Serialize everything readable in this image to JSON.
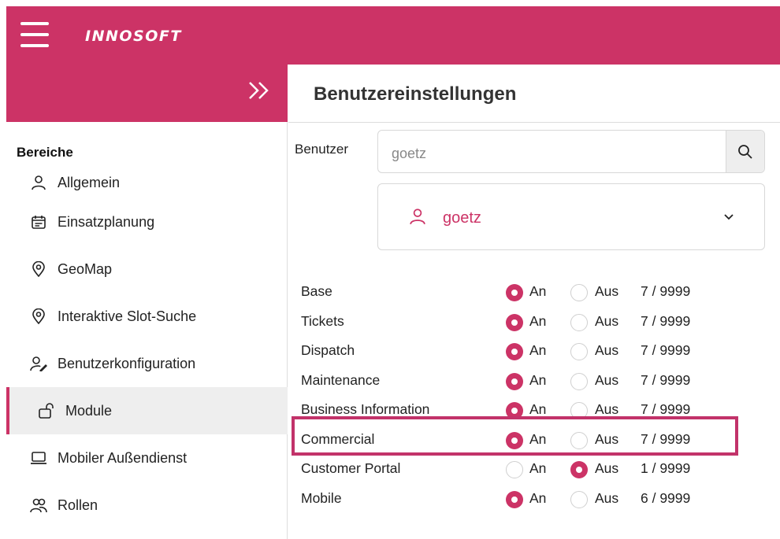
{
  "app": {
    "logo": "INNOSOFT"
  },
  "sidebar": {
    "section_title": "Bereiche",
    "items": [
      {
        "label": "Allgemein",
        "icon": "person-icon"
      },
      {
        "label": "Einsatzplanung",
        "icon": "calendar-icon"
      },
      {
        "label": "GeoMap",
        "icon": "location-pin-icon"
      },
      {
        "label": "Interaktive Slot-Suche",
        "icon": "location-pin-icon"
      },
      {
        "label": "Benutzerkonfiguration",
        "icon": "user-edit-icon"
      },
      {
        "label": "Module",
        "icon": "unlock-icon",
        "active": true
      },
      {
        "label": "Mobiler Außendienst",
        "icon": "laptop-icon"
      },
      {
        "label": "Rollen",
        "icon": "people-icon"
      }
    ]
  },
  "main": {
    "title": "Benutzereinstellungen",
    "user_label": "Benutzer",
    "search": {
      "value": "goetz"
    },
    "selected_user": "goetz",
    "on_label": "An",
    "off_label": "Aus",
    "modules": [
      {
        "name": "Base",
        "state": "An",
        "count": "7 / 9999"
      },
      {
        "name": "Tickets",
        "state": "An",
        "count": "7 / 9999"
      },
      {
        "name": "Dispatch",
        "state": "An",
        "count": "7 / 9999"
      },
      {
        "name": "Maintenance",
        "state": "An",
        "count": "7 / 9999"
      },
      {
        "name": "Business Information",
        "state": "An",
        "count": "7 / 9999"
      },
      {
        "name": "Commercial",
        "state": "An",
        "count": "7 / 9999",
        "highlighted": true
      },
      {
        "name": "Customer Portal",
        "state": "Aus",
        "count": "1 / 9999"
      },
      {
        "name": "Mobile",
        "state": "An",
        "count": "6 / 9999"
      }
    ]
  },
  "colors": {
    "brand": "#cc3366",
    "highlight_border": "#c2336a"
  }
}
